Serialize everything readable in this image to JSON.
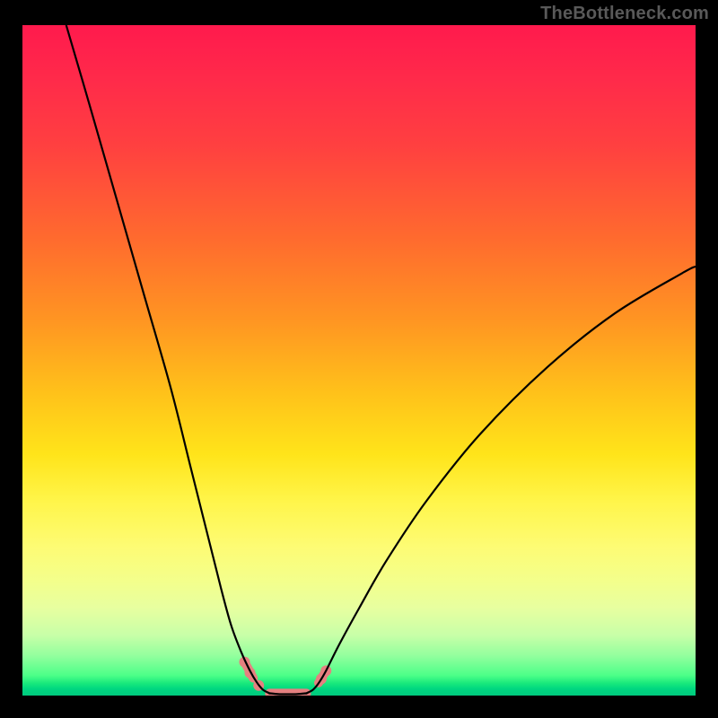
{
  "watermark": "TheBottleneck.com",
  "colors": {
    "frame": "#000000",
    "line": "#000000",
    "marker": "#e58080",
    "gradient_top": "#ff1a4d",
    "gradient_bottom": "#00c97d"
  },
  "chart_data": {
    "type": "line",
    "title": "",
    "xlabel": "",
    "ylabel": "",
    "xlim": [
      0,
      100
    ],
    "ylim": [
      0,
      100
    ],
    "note": "Axes are unlabeled; values are positional percentages estimated from the image. y=0 is the bottom (green) edge, y=100 is the top (red) edge.",
    "series": [
      {
        "name": "left-branch",
        "x": [
          6.5,
          10,
          14,
          18,
          22,
          25,
          27.5,
          29.5,
          31,
          32.5,
          33.8,
          34.8,
          35.7,
          36.7
        ],
        "y": [
          100,
          88,
          74,
          60,
          46,
          34,
          24,
          16,
          10.5,
          6.5,
          3.7,
          2.0,
          0.9,
          0.35
        ]
      },
      {
        "name": "valley-floor",
        "x": [
          36.7,
          38.0,
          39.4,
          40.8,
          42.2
        ],
        "y": [
          0.35,
          0.22,
          0.2,
          0.22,
          0.35
        ]
      },
      {
        "name": "right-branch",
        "x": [
          42.2,
          43.2,
          44.1,
          45.1,
          47,
          50,
          54,
          60,
          68,
          78,
          88,
          98,
          100
        ],
        "y": [
          0.35,
          0.9,
          2.0,
          3.7,
          7.5,
          13,
          20,
          29,
          39,
          49,
          57,
          63,
          64
        ]
      }
    ],
    "markers": {
      "description": "Salmon-colored highlighted segments and dots along the curve near the valley.",
      "dots": [
        {
          "x": 33.0,
          "y": 5.0
        },
        {
          "x": 33.8,
          "y": 3.4
        },
        {
          "x": 35.1,
          "y": 1.5
        },
        {
          "x": 44.4,
          "y": 2.5
        },
        {
          "x": 45.1,
          "y": 3.7
        }
      ],
      "segments": [
        {
          "from": {
            "x": 33.0,
            "y": 5.0
          },
          "to": {
            "x": 34.3,
            "y": 2.6
          }
        },
        {
          "from": {
            "x": 36.7,
            "y": 0.35
          },
          "to": {
            "x": 42.2,
            "y": 0.35
          }
        },
        {
          "from": {
            "x": 44.0,
            "y": 1.9
          },
          "to": {
            "x": 45.1,
            "y": 3.7
          }
        }
      ]
    },
    "background_gradient": {
      "orientation": "vertical",
      "stops": [
        {
          "pos": 0.0,
          "color": "#ff1a4d"
        },
        {
          "pos": 0.32,
          "color": "#ff6b2e"
        },
        {
          "pos": 0.55,
          "color": "#ffc21a"
        },
        {
          "pos": 0.78,
          "color": "#fdfc75"
        },
        {
          "pos": 0.94,
          "color": "#94ff9e"
        },
        {
          "pos": 1.0,
          "color": "#00c97d"
        }
      ]
    }
  }
}
